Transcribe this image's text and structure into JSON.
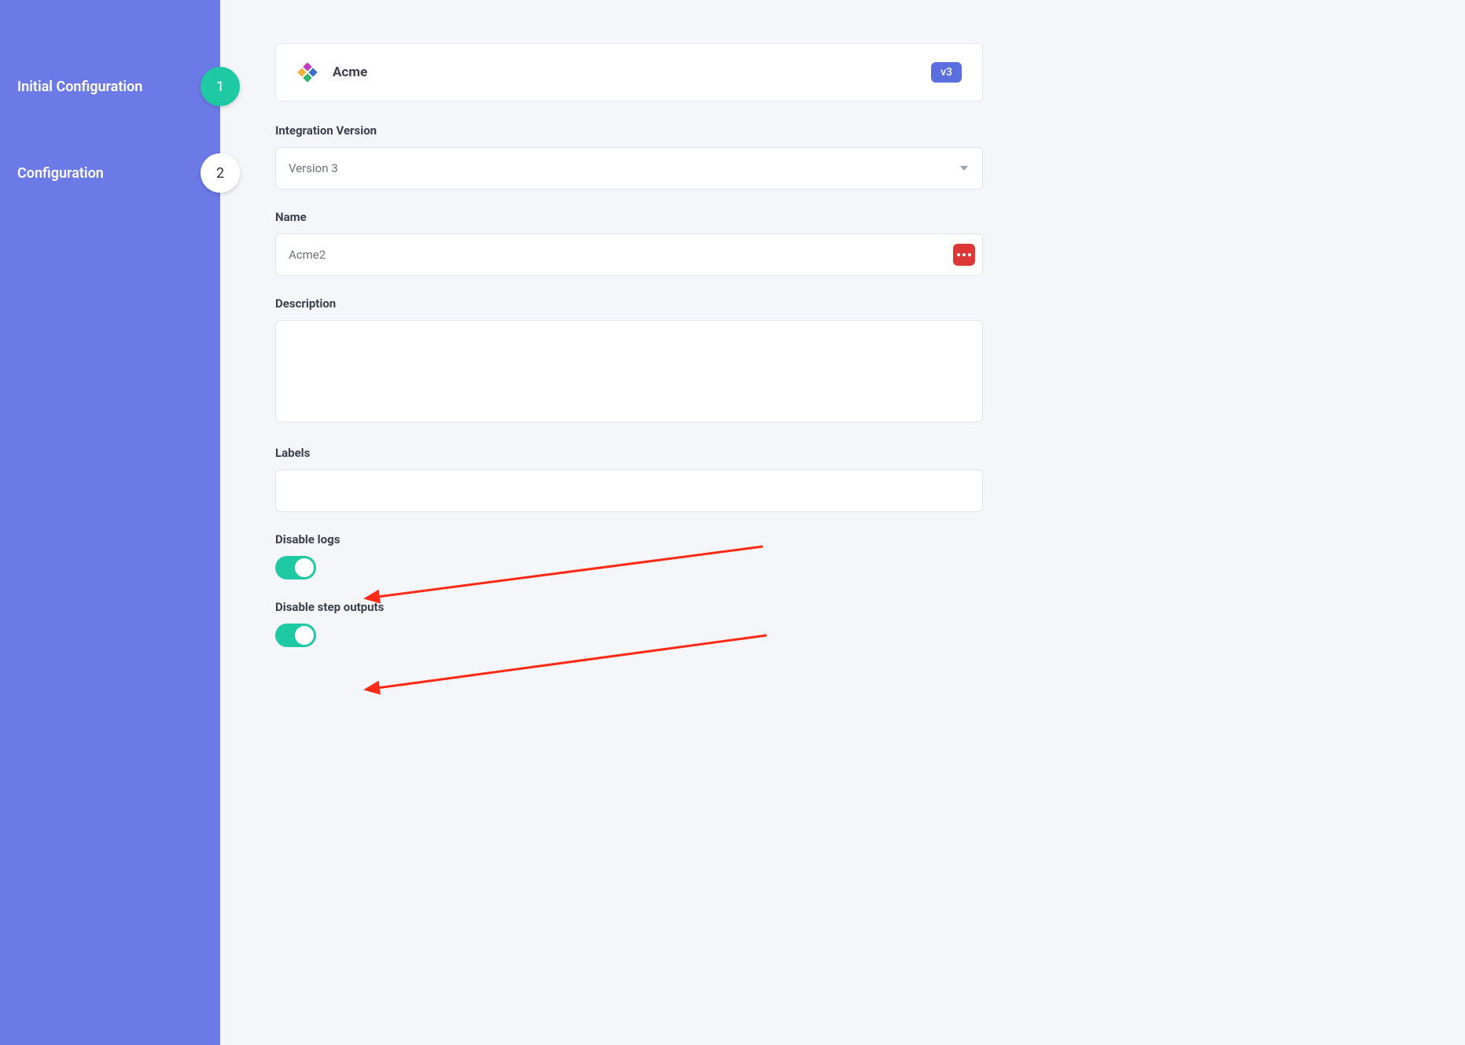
{
  "sidebar": {
    "steps": [
      {
        "label": "Initial Configuration",
        "number": "1",
        "active": true
      },
      {
        "label": "Configuration",
        "number": "2",
        "active": false
      }
    ]
  },
  "header": {
    "title": "Acme",
    "version_badge": "v3"
  },
  "form": {
    "integration_version": {
      "label": "Integration Version",
      "selected": "Version 3"
    },
    "name": {
      "label": "Name",
      "value": "Acme2"
    },
    "description": {
      "label": "Description",
      "value": ""
    },
    "labels": {
      "label": "Labels"
    },
    "disable_logs": {
      "label": "Disable logs",
      "value": true
    },
    "disable_step_outputs": {
      "label": "Disable step outputs",
      "value": true
    }
  }
}
